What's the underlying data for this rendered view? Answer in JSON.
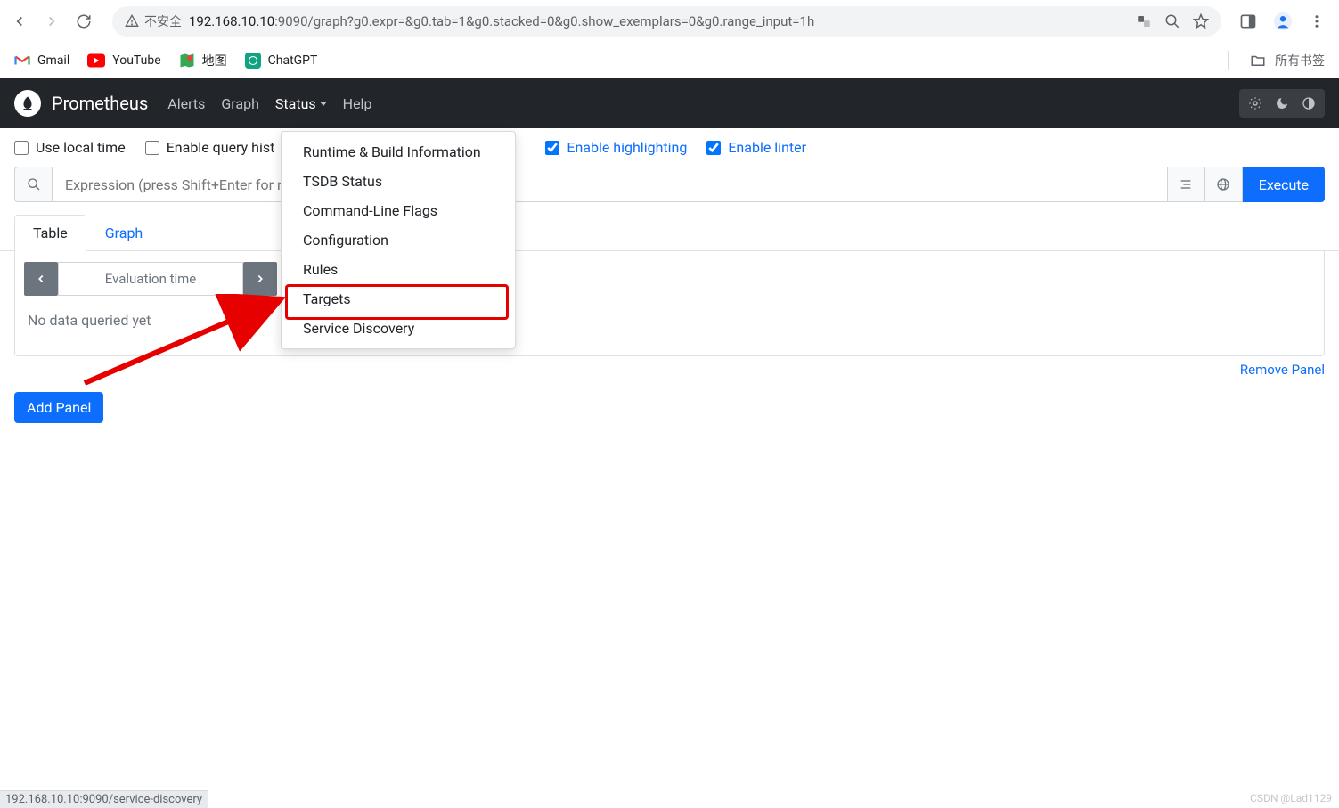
{
  "browser": {
    "security_label": "不安全",
    "url_host": "192.168.10.10",
    "url_rest": ":9090/graph?g0.expr=&g0.tab=1&g0.stacked=0&g0.show_exemplars=0&g0.range_input=1h"
  },
  "bookmarks": {
    "gmail": "Gmail",
    "youtube": "YouTube",
    "maps": "地图",
    "chatgpt": "ChatGPT",
    "all": "所有书签"
  },
  "nav": {
    "brand": "Prometheus",
    "alerts": "Alerts",
    "graph": "Graph",
    "status": "Status",
    "help": "Help"
  },
  "status_menu": {
    "items": [
      "Runtime & Build Information",
      "TSDB Status",
      "Command-Line Flags",
      "Configuration",
      "Rules",
      "Targets",
      "Service Discovery"
    ]
  },
  "options": {
    "use_local_time": "Use local time",
    "enable_query_hist": "Enable query hist",
    "enable_highlighting": "Enable highlighting",
    "enable_linter": "Enable linter"
  },
  "expr": {
    "placeholder": "Expression (press Shift+Enter for ne",
    "execute": "Execute"
  },
  "tabs": {
    "table": "Table",
    "graph": "Graph"
  },
  "panel": {
    "eval_time": "Evaluation time",
    "no_data": "No data queried yet",
    "remove": "Remove Panel",
    "add": "Add Panel"
  },
  "footer": {
    "status_url": "192.168.10.10:9090/service-discovery",
    "watermark": "CSDN @Lad1129"
  }
}
